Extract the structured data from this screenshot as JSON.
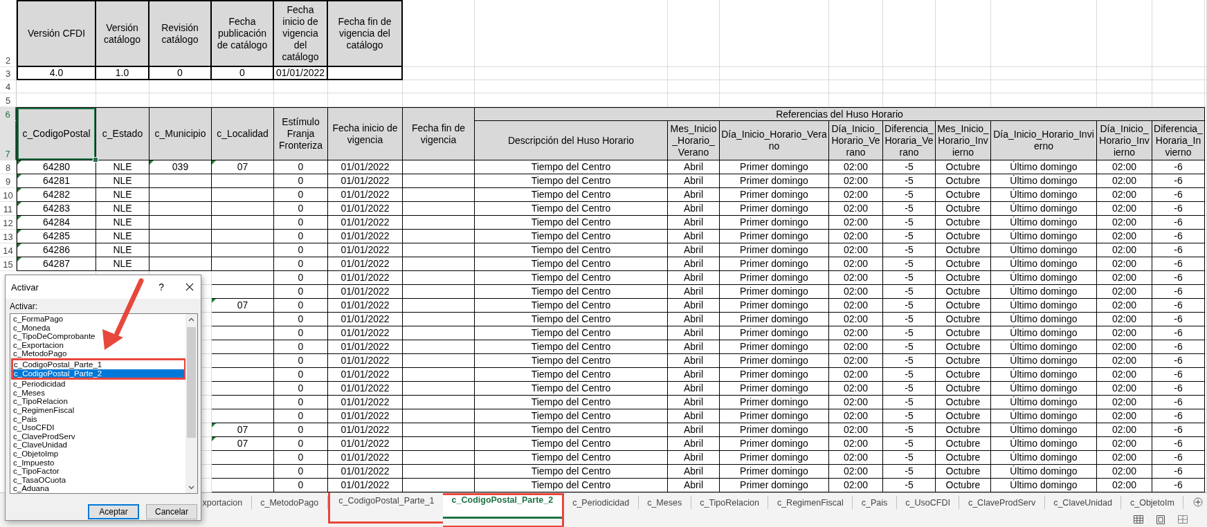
{
  "catalog_info": [
    {
      "header": "Versión CFDI",
      "value": "4.0"
    },
    {
      "header": "Versión catálogo",
      "value": "1.0"
    },
    {
      "header": "Revisión catálogo",
      "value": "0"
    },
    {
      "header": "Fecha publicación de catálogo",
      "value": "0"
    },
    {
      "header": "Fecha inicio de vigencia del catálogo",
      "value": "01/01/2022"
    },
    {
      "header": "Fecha fin de vigencia del catálogo"
    }
  ],
  "row_headers": [
    {
      "label": "2",
      "selected": false
    },
    {
      "label": "3",
      "selected": false
    },
    {
      "label": "4",
      "selected": false
    },
    {
      "label": "5",
      "selected": false
    },
    {
      "label": "6",
      "selected": true
    },
    {
      "label": "7",
      "selected": true
    },
    {
      "label": "8",
      "selected": false
    },
    {
      "label": "9",
      "selected": false
    },
    {
      "label": "10",
      "selected": false
    },
    {
      "label": "11",
      "selected": false
    },
    {
      "label": "12",
      "selected": false
    },
    {
      "label": "13",
      "selected": false
    },
    {
      "label": "14",
      "selected": false
    },
    {
      "label": "15",
      "selected": false
    }
  ],
  "table": {
    "group_header": "Referencias del Huso Horario",
    "columns": [
      {
        "header": "c_CodigoPostal",
        "selected": true
      },
      {
        "header": "c_Estado",
        "selected": false
      },
      {
        "header": "c_Municipio",
        "selected": false
      },
      {
        "header": "c_Localidad",
        "selected": false
      },
      {
        "header": "Estímulo Franja Fronteriza",
        "selected": false
      },
      {
        "header": "Fecha inicio de vigencia",
        "selected": false
      },
      {
        "header": "Fecha fin de vigencia",
        "selected": false
      },
      {
        "header": "Descripción del Huso Horario",
        "selected": false
      },
      {
        "header": "Mes_Inicio_Horario_Verano",
        "selected": false
      },
      {
        "header": "Día_Inicio_Horario_Verano",
        "selected": false
      },
      {
        "header": "Día_Inicio_Horario_Verano",
        "selected": false
      },
      {
        "header": "Diferencia_Horaria_Verano",
        "selected": false
      },
      {
        "header": "Mes_Inicio_Horario_Invierno",
        "selected": false
      },
      {
        "header": "Día_Inicio_Horario_Invierno",
        "selected": false
      },
      {
        "header": "Día_Inicio_Horario_Invierno",
        "selected": false
      },
      {
        "header": "Diferencia_Horaria_Invierno",
        "selected": false
      }
    ],
    "rows": [
      {
        "cp": "64280",
        "estado": "NLE",
        "municipio": "039",
        "localidad": "07",
        "estimulo": "0",
        "fecha_inicio": "01/01/2022",
        "descripcion": "Tiempo del Centro",
        "mes_verano": "Abril",
        "dia_verano": "Primer domingo",
        "hora_verano": "02:00",
        "diferencia_verano": "-5",
        "mes_invierno": "Octubre",
        "dia_invierno": "Último domingo",
        "hora_invierno": "02:00",
        "diferencia_invierno": "-6",
        "flags": {
          "cp": true,
          "municipio": true,
          "localidad": true
        }
      },
      {
        "cp": "64281",
        "estado": "NLE",
        "estimulo": "0",
        "fecha_inicio": "01/01/2022",
        "descripcion": "Tiempo del Centro",
        "mes_verano": "Abril",
        "dia_verano": "Primer domingo",
        "hora_verano": "02:00",
        "diferencia_verano": "-5",
        "mes_invierno": "Octubre",
        "dia_invierno": "Último domingo",
        "hora_invierno": "02:00",
        "diferencia_invierno": "-6",
        "flags": {
          "cp": true,
          "municipio": false,
          "localidad": false
        }
      },
      {
        "cp": "64282",
        "estado": "NLE",
        "estimulo": "0",
        "fecha_inicio": "01/01/2022",
        "descripcion": "Tiempo del Centro",
        "mes_verano": "Abril",
        "dia_verano": "Primer domingo",
        "hora_verano": "02:00",
        "diferencia_verano": "-5",
        "mes_invierno": "Octubre",
        "dia_invierno": "Último domingo",
        "hora_invierno": "02:00",
        "diferencia_invierno": "-6",
        "flags": {
          "cp": true,
          "municipio": false,
          "localidad": false
        }
      },
      {
        "cp": "64283",
        "estado": "NLE",
        "estimulo": "0",
        "fecha_inicio": "01/01/2022",
        "descripcion": "Tiempo del Centro",
        "mes_verano": "Abril",
        "dia_verano": "Primer domingo",
        "hora_verano": "02:00",
        "diferencia_verano": "-5",
        "mes_invierno": "Octubre",
        "dia_invierno": "Último domingo",
        "hora_invierno": "02:00",
        "diferencia_invierno": "-6",
        "flags": {
          "cp": true,
          "municipio": false,
          "localidad": false
        }
      },
      {
        "cp": "64284",
        "estado": "NLE",
        "estimulo": "0",
        "fecha_inicio": "01/01/2022",
        "descripcion": "Tiempo del Centro",
        "mes_verano": "Abril",
        "dia_verano": "Primer domingo",
        "hora_verano": "02:00",
        "diferencia_verano": "-5",
        "mes_invierno": "Octubre",
        "dia_invierno": "Último domingo",
        "hora_invierno": "02:00",
        "diferencia_invierno": "-6",
        "flags": {
          "cp": true,
          "municipio": false,
          "localidad": false
        }
      },
      {
        "cp": "64285",
        "estado": "NLE",
        "estimulo": "0",
        "fecha_inicio": "01/01/2022",
        "descripcion": "Tiempo del Centro",
        "mes_verano": "Abril",
        "dia_verano": "Primer domingo",
        "hora_verano": "02:00",
        "diferencia_verano": "-5",
        "mes_invierno": "Octubre",
        "dia_invierno": "Último domingo",
        "hora_invierno": "02:00",
        "diferencia_invierno": "-6",
        "flags": {
          "cp": true,
          "municipio": false,
          "localidad": false
        }
      },
      {
        "cp": "64286",
        "estado": "NLE",
        "estimulo": "0",
        "fecha_inicio": "01/01/2022",
        "descripcion": "Tiempo del Centro",
        "mes_verano": "Abril",
        "dia_verano": "Primer domingo",
        "hora_verano": "02:00",
        "diferencia_verano": "-5",
        "mes_invierno": "Octubre",
        "dia_invierno": "Último domingo",
        "hora_invierno": "02:00",
        "diferencia_invierno": "-6",
        "flags": {
          "cp": true,
          "municipio": false,
          "localidad": false
        }
      },
      {
        "cp": "64287",
        "estado": "NLE",
        "estimulo": "0",
        "fecha_inicio": "01/01/2022",
        "descripcion": "Tiempo del Centro",
        "mes_verano": "Abril",
        "dia_verano": "Primer domingo",
        "hora_verano": "02:00",
        "diferencia_verano": "-5",
        "mes_invierno": "Octubre",
        "dia_invierno": "Último domingo",
        "hora_invierno": "02:00",
        "diferencia_invierno": "-6",
        "flags": {
          "cp": true,
          "municipio": false,
          "localidad": false
        }
      },
      {
        "estimulo": "0",
        "fecha_inicio": "01/01/2022",
        "descripcion": "Tiempo del Centro",
        "mes_verano": "Abril",
        "dia_verano": "Primer domingo",
        "hora_verano": "02:00",
        "diferencia_verano": "-5",
        "mes_invierno": "Octubre",
        "dia_invierno": "Último domingo",
        "hora_invierno": "02:00",
        "diferencia_invierno": "-6",
        "flags": {
          "localidad": false
        }
      },
      {
        "estimulo": "0",
        "fecha_inicio": "01/01/2022",
        "descripcion": "Tiempo del Centro",
        "mes_verano": "Abril",
        "dia_verano": "Primer domingo",
        "hora_verano": "02:00",
        "diferencia_verano": "-5",
        "mes_invierno": "Octubre",
        "dia_invierno": "Último domingo",
        "hora_invierno": "02:00",
        "diferencia_invierno": "-6",
        "flags": {
          "localidad": false
        }
      },
      {
        "localidad": "07",
        "estimulo": "0",
        "fecha_inicio": "01/01/2022",
        "descripcion": "Tiempo del Centro",
        "mes_verano": "Abril",
        "dia_verano": "Primer domingo",
        "hora_verano": "02:00",
        "diferencia_verano": "-5",
        "mes_invierno": "Octubre",
        "dia_invierno": "Último domingo",
        "hora_invierno": "02:00",
        "diferencia_invierno": "-6",
        "flags": {
          "localidad": true
        }
      },
      {
        "estimulo": "0",
        "fecha_inicio": "01/01/2022",
        "descripcion": "Tiempo del Centro",
        "mes_verano": "Abril",
        "dia_verano": "Primer domingo",
        "hora_verano": "02:00",
        "diferencia_verano": "-5",
        "mes_invierno": "Octubre",
        "dia_invierno": "Último domingo",
        "hora_invierno": "02:00",
        "diferencia_invierno": "-6",
        "flags": {
          "localidad": false
        }
      },
      {
        "estimulo": "0",
        "fecha_inicio": "01/01/2022",
        "descripcion": "Tiempo del Centro",
        "mes_verano": "Abril",
        "dia_verano": "Primer domingo",
        "hora_verano": "02:00",
        "diferencia_verano": "-5",
        "mes_invierno": "Octubre",
        "dia_invierno": "Último domingo",
        "hora_invierno": "02:00",
        "diferencia_invierno": "-6",
        "flags": {
          "localidad": false
        }
      },
      {
        "estimulo": "0",
        "fecha_inicio": "01/01/2022",
        "descripcion": "Tiempo del Centro",
        "mes_verano": "Abril",
        "dia_verano": "Primer domingo",
        "hora_verano": "02:00",
        "diferencia_verano": "-5",
        "mes_invierno": "Octubre",
        "dia_invierno": "Último domingo",
        "hora_invierno": "02:00",
        "diferencia_invierno": "-6",
        "flags": {
          "localidad": false
        }
      },
      {
        "estimulo": "0",
        "fecha_inicio": "01/01/2022",
        "descripcion": "Tiempo del Centro",
        "mes_verano": "Abril",
        "dia_verano": "Primer domingo",
        "hora_verano": "02:00",
        "diferencia_verano": "-5",
        "mes_invierno": "Octubre",
        "dia_invierno": "Último domingo",
        "hora_invierno": "02:00",
        "diferencia_invierno": "-6",
        "flags": {
          "localidad": false
        }
      },
      {
        "estimulo": "0",
        "fecha_inicio": "01/01/2022",
        "descripcion": "Tiempo del Centro",
        "mes_verano": "Abril",
        "dia_verano": "Primer domingo",
        "hora_verano": "02:00",
        "diferencia_verano": "-5",
        "mes_invierno": "Octubre",
        "dia_invierno": "Último domingo",
        "hora_invierno": "02:00",
        "diferencia_invierno": "-6",
        "flags": {
          "localidad": false
        }
      },
      {
        "estimulo": "0",
        "fecha_inicio": "01/01/2022",
        "descripcion": "Tiempo del Centro",
        "mes_verano": "Abril",
        "dia_verano": "Primer domingo",
        "hora_verano": "02:00",
        "diferencia_verano": "-5",
        "mes_invierno": "Octubre",
        "dia_invierno": "Último domingo",
        "hora_invierno": "02:00",
        "diferencia_invierno": "-6",
        "flags": {
          "localidad": false
        }
      },
      {
        "estimulo": "0",
        "fecha_inicio": "01/01/2022",
        "descripcion": "Tiempo del Centro",
        "mes_verano": "Abril",
        "dia_verano": "Primer domingo",
        "hora_verano": "02:00",
        "diferencia_verano": "-5",
        "mes_invierno": "Octubre",
        "dia_invierno": "Último domingo",
        "hora_invierno": "02:00",
        "diferencia_invierno": "-6",
        "flags": {
          "localidad": false
        }
      },
      {
        "estimulo": "0",
        "fecha_inicio": "01/01/2022",
        "descripcion": "Tiempo del Centro",
        "mes_verano": "Abril",
        "dia_verano": "Primer domingo",
        "hora_verano": "02:00",
        "diferencia_verano": "-5",
        "mes_invierno": "Octubre",
        "dia_invierno": "Último domingo",
        "hora_invierno": "02:00",
        "diferencia_invierno": "-6",
        "flags": {
          "localidad": false
        }
      },
      {
        "localidad": "07",
        "estimulo": "0",
        "fecha_inicio": "01/01/2022",
        "descripcion": "Tiempo del Centro",
        "mes_verano": "Abril",
        "dia_verano": "Primer domingo",
        "hora_verano": "02:00",
        "diferencia_verano": "-5",
        "mes_invierno": "Octubre",
        "dia_invierno": "Último domingo",
        "hora_invierno": "02:00",
        "diferencia_invierno": "-6",
        "flags": {
          "localidad": true
        }
      },
      {
        "localidad": "07",
        "estimulo": "0",
        "fecha_inicio": "01/01/2022",
        "descripcion": "Tiempo del Centro",
        "mes_verano": "Abril",
        "dia_verano": "Primer domingo",
        "hora_verano": "02:00",
        "diferencia_verano": "-5",
        "mes_invierno": "Octubre",
        "dia_invierno": "Último domingo",
        "hora_invierno": "02:00",
        "diferencia_invierno": "-6",
        "flags": {
          "localidad": true
        }
      },
      {
        "estimulo": "0",
        "fecha_inicio": "01/01/2022",
        "descripcion": "Tiempo del Centro",
        "mes_verano": "Abril",
        "dia_verano": "Primer domingo",
        "hora_verano": "02:00",
        "diferencia_verano": "-5",
        "mes_invierno": "Octubre",
        "dia_invierno": "Último domingo",
        "hora_invierno": "02:00",
        "diferencia_invierno": "-6",
        "flags": {
          "localidad": false
        }
      },
      {
        "estimulo": "0",
        "fecha_inicio": "01/01/2022",
        "descripcion": "Tiempo del Centro",
        "mes_verano": "Abril",
        "dia_verano": "Primer domingo",
        "hora_verano": "02:00",
        "diferencia_verano": "-5",
        "mes_invierno": "Octubre",
        "dia_invierno": "Último domingo",
        "hora_invierno": "02:00",
        "diferencia_invierno": "-6",
        "flags": {
          "localidad": false
        }
      },
      {
        "estimulo": "0",
        "fecha_inicio": "01/01/2022",
        "descripcion": "Tiempo del Centro",
        "mes_verano": "Abril",
        "dia_verano": "Primer domingo",
        "hora_verano": "02:00",
        "diferencia_verano": "-5",
        "mes_invierno": "Octubre",
        "dia_invierno": "Último domingo",
        "hora_invierno": "02:00",
        "diferencia_invierno": "-6",
        "flags": {
          "localidad": false
        }
      }
    ]
  },
  "dialog": {
    "title": "Activar",
    "help_label": "?",
    "list_label": "Activar:",
    "items": [
      {
        "label": "c_FormaPago",
        "selected": false,
        "highlighted": false
      },
      {
        "label": "c_Moneda",
        "selected": false,
        "highlighted": false
      },
      {
        "label": "c_TipoDeComprobante",
        "selected": false,
        "highlighted": false
      },
      {
        "label": "c_Exportacion",
        "selected": false,
        "highlighted": false
      },
      {
        "label": "c_MetodoPago",
        "selected": false,
        "highlighted": false
      },
      {
        "label": "c_CodigoPostal_Parte_1",
        "selected": false,
        "highlighted": true
      },
      {
        "label": "c_CodigoPostal_Parte_2",
        "selected": true,
        "highlighted": true
      },
      {
        "label": "c_Periodicidad",
        "selected": false,
        "highlighted": false
      },
      {
        "label": "c_Meses",
        "selected": false,
        "highlighted": false
      },
      {
        "label": "c_TipoRelacion",
        "selected": false,
        "highlighted": false
      },
      {
        "label": "c_RegimenFiscal",
        "selected": false,
        "highlighted": false
      },
      {
        "label": "c_Pais",
        "selected": false,
        "highlighted": false
      },
      {
        "label": "c_UsoCFDI",
        "selected": false,
        "highlighted": false
      },
      {
        "label": "c_ClaveProdServ",
        "selected": false,
        "highlighted": false
      },
      {
        "label": "c_ClaveUnidad",
        "selected": false,
        "highlighted": false
      },
      {
        "label": "c_ObjetoImp",
        "selected": false,
        "highlighted": false
      },
      {
        "label": "c_Impuesto",
        "selected": false,
        "highlighted": false
      },
      {
        "label": "c_TipoFactor",
        "selected": false,
        "highlighted": false
      },
      {
        "label": "c_TasaOCuota",
        "selected": false,
        "highlighted": false
      },
      {
        "label": "c_Aduana",
        "selected": false,
        "highlighted": false
      }
    ],
    "buttons": [
      {
        "label": "Aceptar",
        "default": true
      },
      {
        "label": "Cancelar",
        "default": false
      }
    ]
  },
  "tabs": [
    {
      "label": "xportacion",
      "selected": false,
      "highlighted": false
    },
    {
      "label": "c_MetodoPago",
      "selected": false,
      "highlighted": false
    },
    {
      "label": "c_CodigoPostal_Parte_1",
      "selected": false,
      "highlighted": true
    },
    {
      "label": "c_CodigoPostal_Parte_2",
      "selected": true,
      "highlighted": true
    },
    {
      "label": "c_Periodicidad",
      "selected": false,
      "highlighted": false
    },
    {
      "label": "c_Meses",
      "selected": false,
      "highlighted": false
    },
    {
      "label": "c_TipoRelacion",
      "selected": false,
      "highlighted": false
    },
    {
      "label": "c_RegimenFiscal",
      "selected": false,
      "highlighted": false
    },
    {
      "label": "c_Pais",
      "selected": false,
      "highlighted": false
    },
    {
      "label": "c_UsoCFDI",
      "selected": false,
      "highlighted": false
    },
    {
      "label": "c_ClaveProdServ",
      "selected": false,
      "highlighted": false
    },
    {
      "label": "c_ClaveUnidad",
      "selected": false,
      "highlighted": false
    },
    {
      "label": "c_ObjetoIm",
      "selected": false,
      "highlighted": false
    }
  ]
}
